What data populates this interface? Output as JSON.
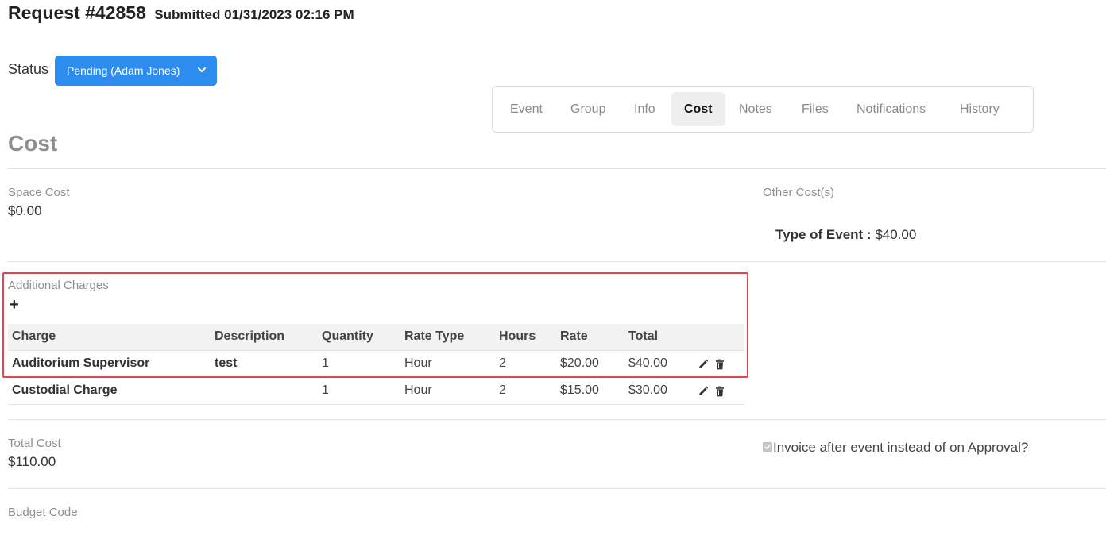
{
  "header": {
    "request_title": "Request #42858",
    "submitted": "Submitted 01/31/2023 02:16 PM"
  },
  "status": {
    "label": "Status",
    "value": "Pending (Adam Jones)",
    "icon": "chevron-down-icon"
  },
  "tabs": [
    {
      "label": "Event"
    },
    {
      "label": "Group"
    },
    {
      "label": "Info"
    },
    {
      "label": "Cost",
      "active": true
    },
    {
      "label": "Notes"
    },
    {
      "label": "Files"
    },
    {
      "label": "Notifications"
    },
    {
      "label": "History"
    }
  ],
  "section_title": "Cost",
  "space_cost": {
    "label": "Space Cost",
    "value": "$0.00"
  },
  "other_costs": {
    "label": "Other Cost(s)",
    "item_label": "Type of Event :",
    "item_value": "$40.00"
  },
  "additional_charges": {
    "label": "Additional Charges",
    "add_symbol": "+",
    "columns": [
      "Charge",
      "Description",
      "Quantity",
      "Rate Type",
      "Hours",
      "Rate",
      "Total"
    ],
    "rows": [
      {
        "charge": "Auditorium Supervisor",
        "description": "test",
        "quantity": "1",
        "rate_type": "Hour",
        "hours": "2",
        "rate": "$20.00",
        "total": "$40.00"
      },
      {
        "charge": "Custodial Charge",
        "description": "",
        "quantity": "1",
        "rate_type": "Hour",
        "hours": "2",
        "rate": "$15.00",
        "total": "$30.00"
      }
    ],
    "row_icons": [
      "pencil-icon",
      "trash-icon"
    ]
  },
  "total_cost": {
    "label": "Total Cost",
    "value": "$110.00"
  },
  "invoice_option": {
    "label": "Invoice after event instead of on Approval?",
    "checked": true
  },
  "budget_code": {
    "label": "Budget Code"
  },
  "colors": {
    "accent": "#2d8cf0",
    "highlight_border": "#e2454a"
  }
}
